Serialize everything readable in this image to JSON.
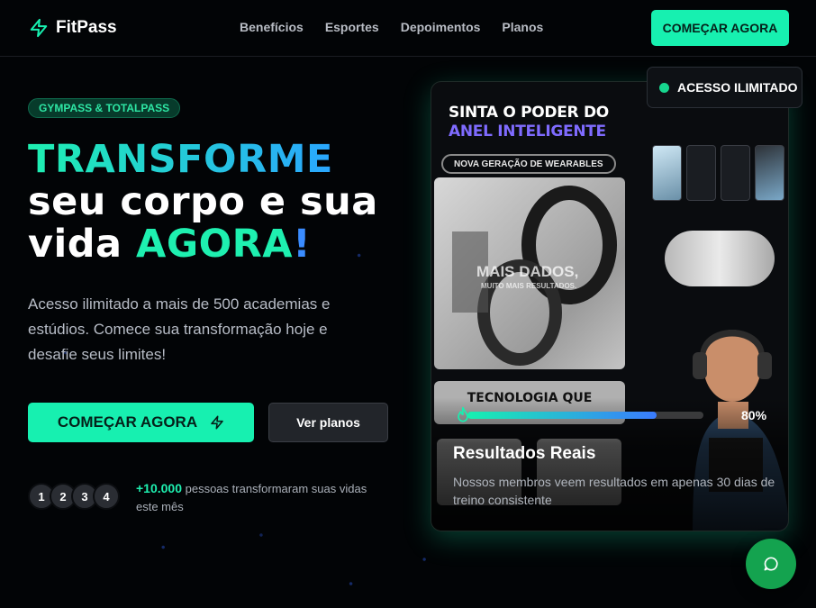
{
  "header": {
    "brand": "FitPass",
    "nav": [
      "Benefícios",
      "Esportes",
      "Depoimentos",
      "Planos"
    ],
    "cta": "COMEÇAR AGORA"
  },
  "hero": {
    "badge": "GYMPASS & TOTALPASS",
    "title_line1": "TRANSFORME",
    "title_line2": "seu corpo e sua",
    "title_line3_a": "vida ",
    "title_line3_b": "AGORA",
    "title_line3_c": "!",
    "lead": "Acesso ilimitado a mais de 500 academias e estúdios. Comece sua transformação hoje e desafie seus limites!",
    "primary_button": "COMEÇAR AGORA",
    "secondary_button": "Ver planos",
    "avatars": [
      "1",
      "2",
      "3",
      "4"
    ],
    "social_count": "+10.000",
    "social_text": " pessoas transformaram suas vidas este mês"
  },
  "card": {
    "ad_line1": "SINTA O PODER DO",
    "ad_line2": "ANEL INTELIGENTE",
    "ad_pill": "NOVA GERAÇÃO DE WEARABLES",
    "ring_text": "MAIS DADOS,",
    "ring_subtext": "MUITO MAIS RESULTADOS.",
    "tech_text": "TECNOLOGIA QUE",
    "progress": 0.8,
    "progress_label": "80%",
    "results_title": "Resultados Reais",
    "results_desc": "Nossos membros veem resultados em apenas 30 dias de treino consistente"
  },
  "badge_unlimited": "ACESSO ILIMITADO",
  "colors": {
    "accent": "#17f0b0",
    "blue": "#3a8cff",
    "background": "#020406"
  },
  "icons": [
    "bolt-icon",
    "flame-icon",
    "chat-icon"
  ]
}
